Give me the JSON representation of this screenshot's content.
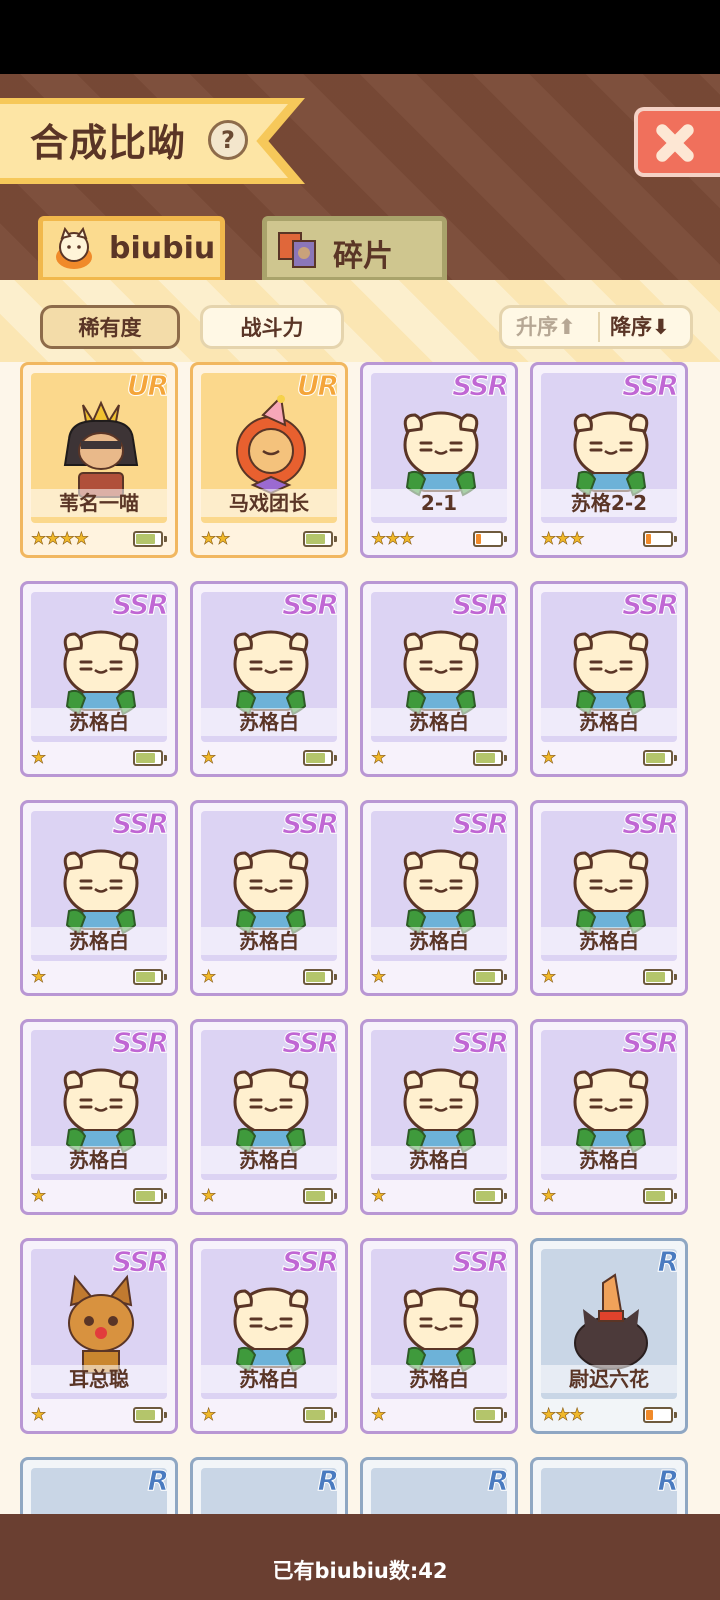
{
  "header": {
    "title": "合成比呦",
    "help_glyph": "?"
  },
  "tabs": [
    {
      "label": "biubiu",
      "active": true
    },
    {
      "label": "碎片",
      "active": false
    }
  ],
  "filters": {
    "sort_by": [
      {
        "label": "稀有度",
        "active": true
      },
      {
        "label": "战斗力",
        "active": false
      }
    ],
    "order": [
      {
        "label": "升序⬆",
        "active": false
      },
      {
        "label": "降序⬇",
        "active": true
      }
    ]
  },
  "cards": [
    {
      "rarity": "UR",
      "name": "苇名一喵",
      "stars": 4,
      "battery": 0.8,
      "art": "samurai"
    },
    {
      "rarity": "UR",
      "name": "马戏团长",
      "stars": 2,
      "battery": 0.8,
      "art": "lion"
    },
    {
      "rarity": "SSR",
      "name": "2-1",
      "stars": 3,
      "battery": 0.2,
      "art": "cat"
    },
    {
      "rarity": "SSR",
      "name": "苏格2-2",
      "stars": 3,
      "battery": 0.2,
      "art": "cat"
    },
    {
      "rarity": "SSR",
      "name": "苏格白",
      "stars": 1,
      "battery": 0.8,
      "art": "cat"
    },
    {
      "rarity": "SSR",
      "name": "苏格白",
      "stars": 1,
      "battery": 0.8,
      "art": "cat"
    },
    {
      "rarity": "SSR",
      "name": "苏格白",
      "stars": 1,
      "battery": 0.8,
      "art": "cat"
    },
    {
      "rarity": "SSR",
      "name": "苏格白",
      "stars": 1,
      "battery": 0.8,
      "art": "cat"
    },
    {
      "rarity": "SSR",
      "name": "苏格白",
      "stars": 1,
      "battery": 0.8,
      "art": "cat"
    },
    {
      "rarity": "SSR",
      "name": "苏格白",
      "stars": 1,
      "battery": 0.8,
      "art": "cat"
    },
    {
      "rarity": "SSR",
      "name": "苏格白",
      "stars": 1,
      "battery": 0.8,
      "art": "cat"
    },
    {
      "rarity": "SSR",
      "name": "苏格白",
      "stars": 1,
      "battery": 0.8,
      "art": "cat"
    },
    {
      "rarity": "SSR",
      "name": "苏格白",
      "stars": 1,
      "battery": 0.8,
      "art": "cat"
    },
    {
      "rarity": "SSR",
      "name": "苏格白",
      "stars": 1,
      "battery": 0.8,
      "art": "cat"
    },
    {
      "rarity": "SSR",
      "name": "苏格白",
      "stars": 1,
      "battery": 0.8,
      "art": "cat"
    },
    {
      "rarity": "SSR",
      "name": "苏格白",
      "stars": 1,
      "battery": 0.8,
      "art": "cat"
    },
    {
      "rarity": "SSR",
      "name": "耳总聪",
      "stars": 1,
      "battery": 0.8,
      "art": "serval"
    },
    {
      "rarity": "SSR",
      "name": "苏格白",
      "stars": 1,
      "battery": 0.8,
      "art": "cat"
    },
    {
      "rarity": "SSR",
      "name": "苏格白",
      "stars": 1,
      "battery": 0.8,
      "art": "cat"
    },
    {
      "rarity": "R",
      "name": "尉迟六花",
      "stars": 3,
      "battery": 0.3,
      "art": "blackcat"
    },
    {
      "rarity": "R",
      "name": "",
      "stars": 0,
      "battery": 0,
      "art": ""
    },
    {
      "rarity": "R",
      "name": "",
      "stars": 0,
      "battery": 0,
      "art": ""
    },
    {
      "rarity": "R",
      "name": "",
      "stars": 0,
      "battery": 0,
      "art": ""
    },
    {
      "rarity": "R",
      "name": "",
      "stars": 0,
      "battery": 0,
      "art": ""
    }
  ],
  "footer": {
    "count_text": "已有biubiu数:42"
  }
}
